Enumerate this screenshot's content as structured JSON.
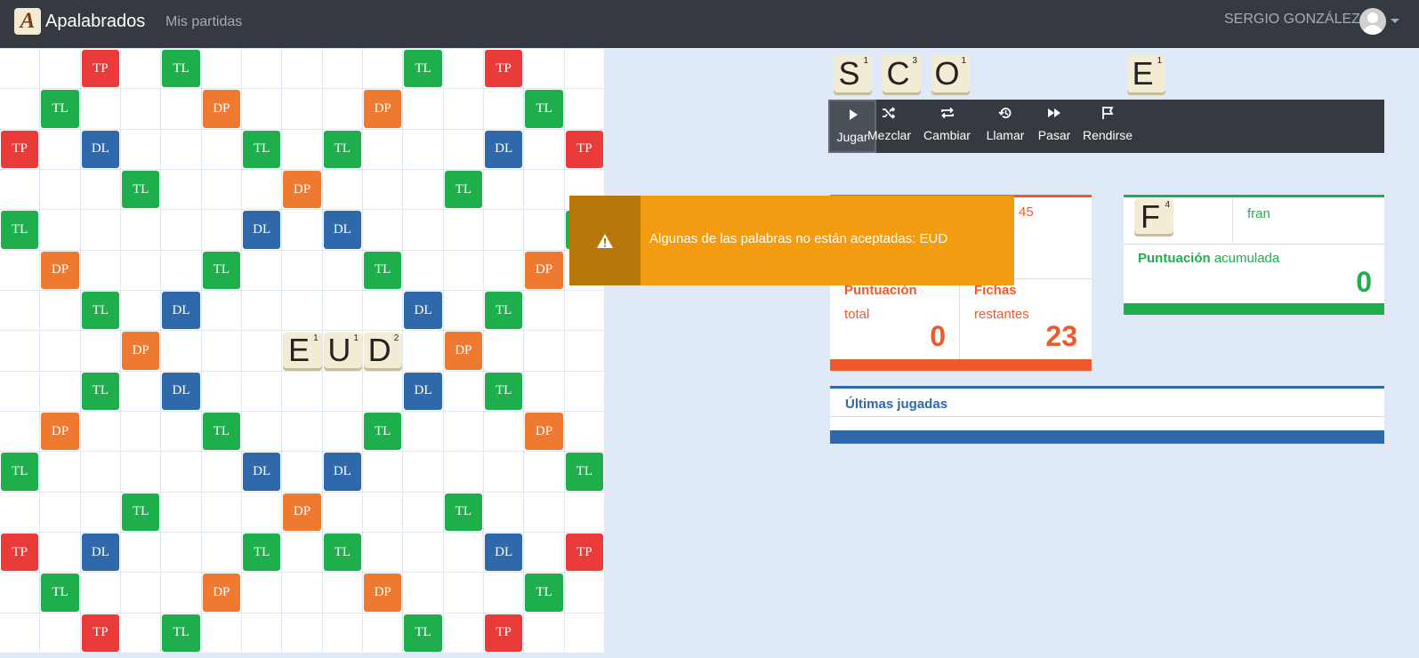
{
  "navbar": {
    "brand_logo_letter": "A",
    "brand_name": "Apalabrados",
    "nav_link": "Mis partidas",
    "user_name": "SERGIO GONZÁLEZ"
  },
  "board": {
    "size": 15,
    "bonus_rows": [
      [
        "",
        "",
        "TP",
        "",
        "TL",
        "",
        "",
        "",
        "",
        "",
        "TL",
        "",
        "TP",
        "",
        ""
      ],
      [
        "",
        "TL",
        "",
        "",
        "",
        "DP",
        "",
        "",
        "",
        "DP",
        "",
        "",
        "",
        "TL",
        ""
      ],
      [
        "TP",
        "",
        "DL",
        "",
        "",
        "",
        "TL",
        "",
        "TL",
        "",
        "",
        "",
        "DL",
        "",
        "TP"
      ],
      [
        "",
        "",
        "",
        "TL",
        "",
        "",
        "",
        "DP",
        "",
        "",
        "",
        "TL",
        "",
        "",
        ""
      ],
      [
        "TL",
        "",
        "",
        "",
        "",
        "",
        "DL",
        "",
        "DL",
        "",
        "",
        "",
        "",
        "",
        "TL"
      ],
      [
        "",
        "DP",
        "",
        "",
        "",
        "TL",
        "",
        "",
        "",
        "TL",
        "",
        "",
        "",
        "DP",
        ""
      ],
      [
        "",
        "",
        "TL",
        "",
        "DL",
        "",
        "",
        "",
        "",
        "",
        "DL",
        "",
        "TL",
        "",
        ""
      ],
      [
        "",
        "",
        "",
        "DP",
        "",
        "",
        "",
        "",
        "",
        "",
        "",
        "DP",
        "",
        "",
        ""
      ],
      [
        "",
        "",
        "TL",
        "",
        "DL",
        "",
        "",
        "",
        "",
        "",
        "DL",
        "",
        "TL",
        "",
        ""
      ],
      [
        "",
        "DP",
        "",
        "",
        "",
        "TL",
        "",
        "",
        "",
        "TL",
        "",
        "",
        "",
        "DP",
        ""
      ],
      [
        "TL",
        "",
        "",
        "",
        "",
        "",
        "DL",
        "",
        "DL",
        "",
        "",
        "",
        "",
        "",
        "TL"
      ],
      [
        "",
        "",
        "",
        "TL",
        "",
        "",
        "",
        "DP",
        "",
        "",
        "",
        "TL",
        "",
        "",
        ""
      ],
      [
        "TP",
        "",
        "DL",
        "",
        "",
        "",
        "TL",
        "",
        "TL",
        "",
        "",
        "",
        "DL",
        "",
        "TP"
      ],
      [
        "",
        "TL",
        "",
        "",
        "",
        "DP",
        "",
        "",
        "",
        "DP",
        "",
        "",
        "",
        "TL",
        ""
      ],
      [
        "",
        "",
        "TP",
        "",
        "TL",
        "",
        "",
        "",
        "",
        "",
        "TL",
        "",
        "TP",
        "",
        ""
      ]
    ],
    "placed_tiles": [
      {
        "letter": "E",
        "points": "1",
        "row": 7,
        "col": 7
      },
      {
        "letter": "U",
        "points": "1",
        "row": 7,
        "col": 8
      },
      {
        "letter": "D",
        "points": "2",
        "row": 7,
        "col": 9
      }
    ]
  },
  "rack": [
    {
      "letter": "S",
      "points": "1",
      "slot": 0
    },
    {
      "letter": "C",
      "points": "3",
      "slot": 1
    },
    {
      "letter": "O",
      "points": "1",
      "slot": 2
    },
    {
      "letter": "E",
      "points": "1",
      "slot": 6
    }
  ],
  "toolbar": {
    "buttons": [
      {
        "label": "Jugar",
        "icon": "play-icon",
        "active": true
      },
      {
        "label": "Mezclar",
        "icon": "shuffle-icon",
        "active": false
      },
      {
        "label": "Cambiar",
        "icon": "repeat-icon",
        "active": false
      },
      {
        "label": "Llamar",
        "icon": "history-icon",
        "active": false
      },
      {
        "label": "Pasar",
        "icon": "fast-forward-icon",
        "active": false
      },
      {
        "label": "Rendirse",
        "icon": "flag-icon",
        "active": false
      }
    ]
  },
  "alert": {
    "icon": "warning-icon",
    "message": "Algunas de las palabras no están aceptadas: EUD"
  },
  "my_panel": {
    "partial_number": "45",
    "score_title": "Puntuación",
    "score_sub": "total",
    "score_value": "0",
    "tiles_title": "Fichas",
    "tiles_sub": "restantes",
    "tiles_value": "23"
  },
  "opponent_panel": {
    "tile_letter": "F",
    "tile_points": "4",
    "name": "fran",
    "score_title": "Puntuación",
    "score_sub": "acumulada",
    "score_value": "0"
  },
  "last_plays": {
    "title": "Últimas jugadas"
  },
  "colors": {
    "navbar": "#343a40",
    "background": "#e0e9f8",
    "TP": "#ea3a3a",
    "TL": "#1fae4c",
    "DP": "#ee7a31",
    "DL": "#2f69ab",
    "alert": "#f39c12",
    "tile": "#f3ecd5"
  }
}
